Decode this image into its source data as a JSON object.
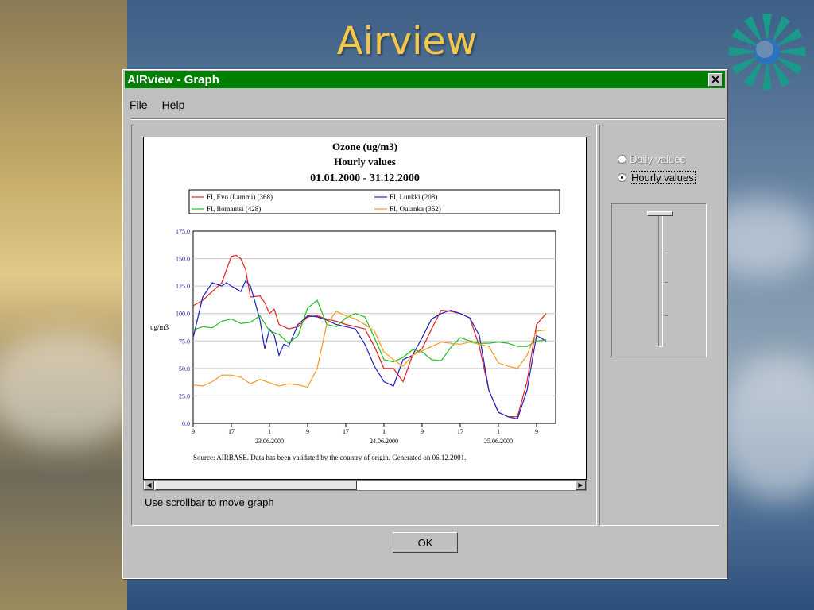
{
  "slide": {
    "title": "Airview"
  },
  "window": {
    "title": "AIRview - Graph",
    "close_label": "✕",
    "menu": [
      "File",
      "Help"
    ],
    "scroll_hint": "Use scrollbar to move graph",
    "ok_label": "OK",
    "radio_daily": "Daily values",
    "radio_hourly": "Hourly values"
  },
  "colors": {
    "titlebar": "#008000",
    "slide_title": "#f3c74a"
  },
  "chart_data": {
    "type": "line",
    "title_lines": [
      "Ozone (ug/m3)",
      "Hourly values",
      "01.01.2000 - 31.12.2000"
    ],
    "ylabel": "ug/m3",
    "ylim": [
      0,
      175
    ],
    "yticks": [
      0,
      25,
      50,
      75,
      100,
      125,
      150,
      175
    ],
    "ytick_labels": [
      "0.0",
      "25.0",
      "50.0",
      "75.0",
      "100.0",
      "125.0",
      "150.0",
      "175.0"
    ],
    "xlim": [
      0,
      55
    ],
    "x_tick_positions": [
      0,
      8,
      16,
      24,
      32,
      40,
      48,
      56,
      64,
      72
    ],
    "x_tick_labels": [
      "9",
      "17",
      "1",
      "9",
      "17",
      "1",
      "9",
      "17",
      "1",
      "9"
    ],
    "date_labels": [
      {
        "x": 16,
        "label": "23.06.2000"
      },
      {
        "x": 40,
        "label": "24.06.2000"
      },
      {
        "x": 64,
        "label": "25.06.2000"
      }
    ],
    "x_range": [
      0,
      76
    ],
    "source": "Source: AIRBASE. Data has been validated by the country of origin. Generated on 06.12.2001.",
    "series": [
      {
        "name": "FI, Evo (Lammi) (368)",
        "color": "#e02020",
        "x": [
          0,
          2,
          4,
          6,
          8,
          9,
          10,
          11,
          12,
          14,
          15,
          16,
          17,
          18,
          20,
          22,
          24,
          26,
          28,
          30,
          32,
          34,
          36,
          38,
          40,
          42,
          44,
          46,
          48,
          50,
          52,
          54,
          56,
          58,
          60,
          62,
          64,
          66,
          68,
          70,
          72,
          74
        ],
        "y": [
          107,
          112,
          120,
          128,
          152,
          153,
          150,
          140,
          115,
          116,
          110,
          100,
          104,
          90,
          86,
          88,
          97,
          98,
          95,
          93,
          90,
          88,
          86,
          70,
          50,
          50,
          38,
          62,
          68,
          86,
          103,
          102,
          100,
          96,
          70,
          30,
          10,
          6,
          6,
          38,
          90,
          100
        ]
      },
      {
        "name": "FI, Luukki (208)",
        "color": "#2020c0",
        "x": [
          0,
          2,
          4,
          6,
          7,
          8,
          10,
          11,
          12,
          13,
          14,
          15,
          16,
          17,
          18,
          19,
          20,
          21,
          22,
          24,
          26,
          28,
          30,
          32,
          34,
          36,
          38,
          40,
          42,
          44,
          46,
          48,
          50,
          52,
          54,
          56,
          58,
          60,
          62,
          64,
          66,
          68,
          70,
          72,
          74
        ],
        "y": [
          78,
          115,
          128,
          125,
          128,
          125,
          120,
          130,
          125,
          110,
          94,
          68,
          86,
          80,
          62,
          72,
          70,
          80,
          90,
          98,
          97,
          94,
          90,
          88,
          86,
          72,
          52,
          38,
          34,
          58,
          62,
          78,
          95,
          100,
          103,
          100,
          96,
          80,
          30,
          10,
          6,
          4,
          30,
          80,
          75
        ]
      },
      {
        "name": "FI, Ilomantsi (428)",
        "color": "#20c020",
        "x": [
          0,
          2,
          4,
          6,
          8,
          10,
          12,
          14,
          16,
          18,
          20,
          22,
          24,
          26,
          28,
          30,
          32,
          34,
          36,
          38,
          40,
          42,
          44,
          46,
          48,
          50,
          52,
          54,
          56,
          58,
          60,
          62,
          64,
          66,
          68,
          70,
          72,
          74
        ],
        "y": [
          85,
          88,
          87,
          93,
          95,
          91,
          92,
          98,
          84,
          81,
          73,
          80,
          105,
          112,
          90,
          88,
          96,
          100,
          97,
          78,
          58,
          56,
          60,
          67,
          65,
          58,
          57,
          69,
          78,
          75,
          73,
          73,
          74,
          73,
          70,
          70,
          75,
          76
        ]
      },
      {
        "name": "FI, Oulanka (352)",
        "color": "#f59a20",
        "x": [
          0,
          2,
          4,
          6,
          8,
          10,
          12,
          14,
          16,
          18,
          20,
          22,
          24,
          26,
          28,
          30,
          32,
          34,
          36,
          38,
          40,
          42,
          44,
          46,
          48,
          50,
          52,
          54,
          56,
          58,
          60,
          62,
          64,
          66,
          68,
          70,
          72,
          74
        ],
        "y": [
          35,
          34,
          38,
          44,
          44,
          42,
          36,
          40,
          37,
          34,
          36,
          35,
          33,
          50,
          90,
          102,
          98,
          95,
          90,
          84,
          65,
          58,
          52,
          62,
          66,
          70,
          74,
          73,
          72,
          74,
          72,
          70,
          55,
          52,
          50,
          62,
          84,
          85
        ]
      }
    ]
  }
}
